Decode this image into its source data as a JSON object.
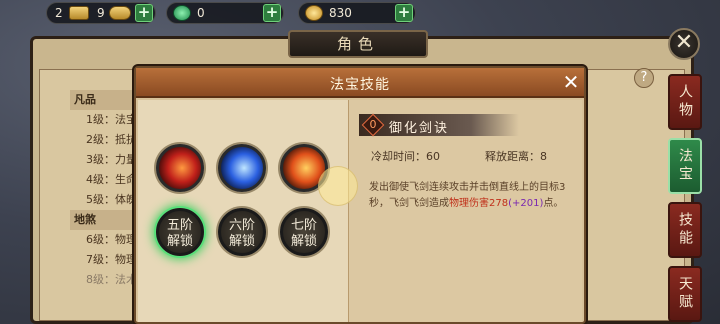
{
  "topbar": {
    "gold_bars": "2",
    "gold_ingots": "9",
    "jade": "0",
    "coins": "830"
  },
  "role_title": "角色",
  "left_list": [
    {
      "type": "hdr",
      "text": "凡品"
    },
    {
      "type": "row",
      "text": "1级：法宝"
    },
    {
      "type": "row",
      "text": "2级：抵抗"
    },
    {
      "type": "row",
      "text": "3级：力量"
    },
    {
      "type": "row",
      "text": "4级：生命"
    },
    {
      "type": "row",
      "text": "5级：体魄"
    },
    {
      "type": "hdr",
      "text": "地煞"
    },
    {
      "type": "row",
      "text": "6级：物理"
    },
    {
      "type": "row",
      "text": "7级：物理"
    },
    {
      "type": "dim",
      "text": "8级：法术"
    }
  ],
  "side_tabs": [
    "人物",
    "法宝",
    "技能",
    "天赋"
  ],
  "dialog": {
    "title": "法宝技能",
    "locks": [
      "五阶\n解锁",
      "六阶\n解锁",
      "七阶\n解锁"
    ],
    "skill": {
      "badge": "0",
      "name": "御化剑诀",
      "cooldown_label": "冷却时间：60",
      "range_label": "释放距离：8",
      "desc_pre": "发出御使飞剑连续攻击并击倒直线上的目标3秒，飞剑飞剑造成",
      "desc_dmg": "物理伤害278",
      "desc_bonus": "(+201)",
      "desc_post": "点。"
    }
  }
}
